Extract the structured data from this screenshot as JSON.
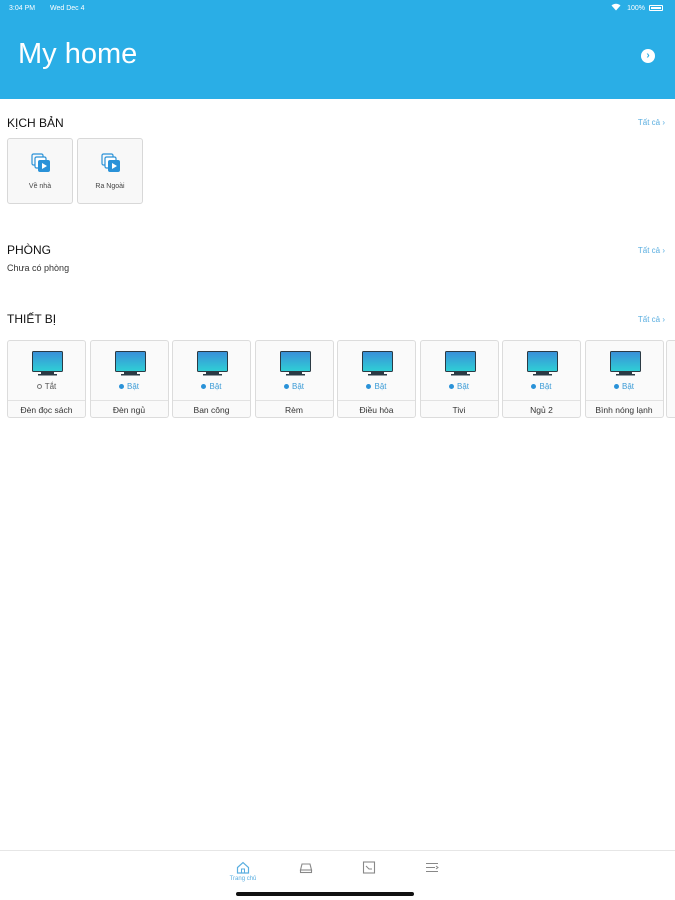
{
  "status_bar": {
    "time": "3:04 PM",
    "date": "Wed Dec 4",
    "battery": "100%"
  },
  "header": {
    "title": "My home",
    "action_icon": "chevron-right-circle-icon"
  },
  "scenes": {
    "title": "KỊCH BẢN",
    "see_all": "Tất cả",
    "items": [
      {
        "label": "Về nhà"
      },
      {
        "label": "Ra Ngoài"
      }
    ]
  },
  "rooms": {
    "title": "PHÒNG",
    "see_all": "Tất cả",
    "empty_text": "Chưa có phòng"
  },
  "devices": {
    "title": "THIẾT BỊ",
    "see_all": "Tất cả",
    "items": [
      {
        "state": "Tắt",
        "on": false,
        "name": "Đèn đọc sách"
      },
      {
        "state": "Bật",
        "on": true,
        "name": "Đèn ngủ"
      },
      {
        "state": "Bật",
        "on": true,
        "name": "Ban công"
      },
      {
        "state": "Bật",
        "on": true,
        "name": "Rèm"
      },
      {
        "state": "Bật",
        "on": true,
        "name": "Điều hòa"
      },
      {
        "state": "Bật",
        "on": true,
        "name": "Tivi"
      },
      {
        "state": "Bật",
        "on": true,
        "name": "Ngủ 2"
      },
      {
        "state": "Bật",
        "on": true,
        "name": "Bình nóng lạnh"
      }
    ]
  },
  "tabbar": {
    "items": [
      {
        "icon": "home-icon",
        "label": "Trang chủ",
        "active": true
      },
      {
        "icon": "device-icon",
        "label": ""
      },
      {
        "icon": "chart-icon",
        "label": ""
      },
      {
        "icon": "menu-icon",
        "label": ""
      }
    ]
  },
  "colors": {
    "header": "#2aaee6",
    "accent": "#2a92d8",
    "link": "#5aaee0"
  }
}
